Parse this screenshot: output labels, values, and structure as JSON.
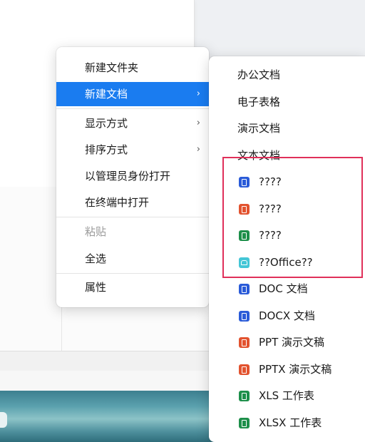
{
  "context_menu": {
    "items": [
      {
        "label": "新建文件夹"
      },
      {
        "label": "新建文档",
        "chevron": "›"
      },
      {
        "label": "显示方式",
        "chevron": "›"
      },
      {
        "label": "排序方式",
        "chevron": "›"
      },
      {
        "label": "以管理员身份打开"
      },
      {
        "label": "在终端中打开"
      },
      {
        "label": "粘贴"
      },
      {
        "label": "全选"
      },
      {
        "label": "属性"
      }
    ]
  },
  "submenu": {
    "items": [
      {
        "label": "办公文档"
      },
      {
        "label": "电子表格"
      },
      {
        "label": "演示文档"
      },
      {
        "label": "文本文档"
      },
      {
        "label": "????",
        "icon": "wps-writer-icon"
      },
      {
        "label": "????",
        "icon": "wps-presentation-icon"
      },
      {
        "label": "????",
        "icon": "wps-spreadsheet-icon"
      },
      {
        "label": "??Office??",
        "icon": "wps-cloud-office-icon"
      },
      {
        "label": "DOC 文档",
        "icon": "wps-writer-icon"
      },
      {
        "label": "DOCX 文档",
        "icon": "wps-writer-icon"
      },
      {
        "label": "PPT 演示文稿",
        "icon": "wps-presentation-icon"
      },
      {
        "label": "PPTX 演示文稿",
        "icon": "wps-presentation-icon"
      },
      {
        "label": "XLS 工作表",
        "icon": "wps-spreadsheet-icon"
      },
      {
        "label": "XLSX 工作表",
        "icon": "wps-spreadsheet-icon"
      }
    ]
  },
  "colors": {
    "accent": "#1a7cf0",
    "highlight_border": "#e0305a",
    "wps_writer": "#2a5bd8",
    "wps_presentation": "#e2532f",
    "wps_spreadsheet": "#1d8f4a",
    "wps_cloud": "#44c6d6"
  }
}
